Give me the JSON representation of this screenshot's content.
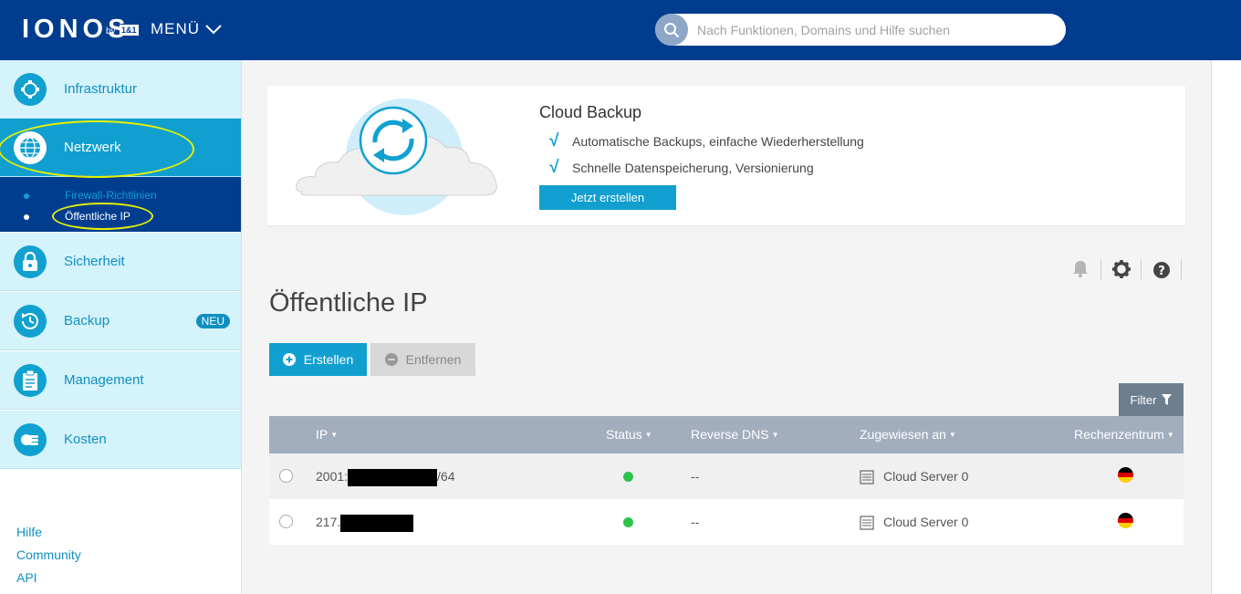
{
  "header": {
    "logo": "IONOS",
    "logo_by": "by",
    "logo_brand": "1&1",
    "menu_label": "MENÜ",
    "search_placeholder": "Nach Funktionen, Domains und Hilfe suchen"
  },
  "sidebar": {
    "items": [
      {
        "label": "Infrastruktur",
        "icon": "infrastructure-icon"
      },
      {
        "label": "Netzwerk",
        "icon": "globe-network-icon",
        "active": true
      },
      {
        "label": "Sicherheit",
        "icon": "lock-icon"
      },
      {
        "label": "Backup",
        "icon": "backup-clock-icon",
        "badge": "NEU"
      },
      {
        "label": "Management",
        "icon": "clipboard-icon"
      },
      {
        "label": "Kosten",
        "icon": "coins-icon"
      }
    ],
    "subitems": [
      {
        "label": "Firewall-Richtlinien"
      },
      {
        "label": "Öffentliche IP",
        "active": true
      }
    ],
    "links": [
      "Hilfe",
      "Community",
      "API"
    ]
  },
  "promo": {
    "title": "Cloud Backup",
    "features": [
      "Automatische Backups, einfache Wiederherstellung",
      "Schnelle Datenspeicherung, Versionierung"
    ],
    "button": "Jetzt erstellen"
  },
  "page": {
    "title": "Öffentliche IP",
    "create_label": "Erstellen",
    "remove_label": "Entfernen",
    "filter_label": "Filter"
  },
  "table": {
    "headers": [
      "IP",
      "Status",
      "Reverse DNS",
      "Zugewiesen an",
      "Rechenzentrum"
    ],
    "rows": [
      {
        "ip_prefix": "2001:",
        "ip_suffix": "/64",
        "status": "active",
        "reverse_dns": "--",
        "assigned": "Cloud Server 0",
        "datacenter": "de"
      },
      {
        "ip_prefix": "217.",
        "ip_suffix": "",
        "status": "active",
        "reverse_dns": "--",
        "assigned": "Cloud Server 0",
        "datacenter": "de"
      }
    ]
  },
  "colors": {
    "header_bg": "#003d8f",
    "accent": "#119fd0",
    "nav_bg": "#d5f3fb",
    "status_green": "#2ec24b",
    "table_header": "#a2adbd"
  }
}
